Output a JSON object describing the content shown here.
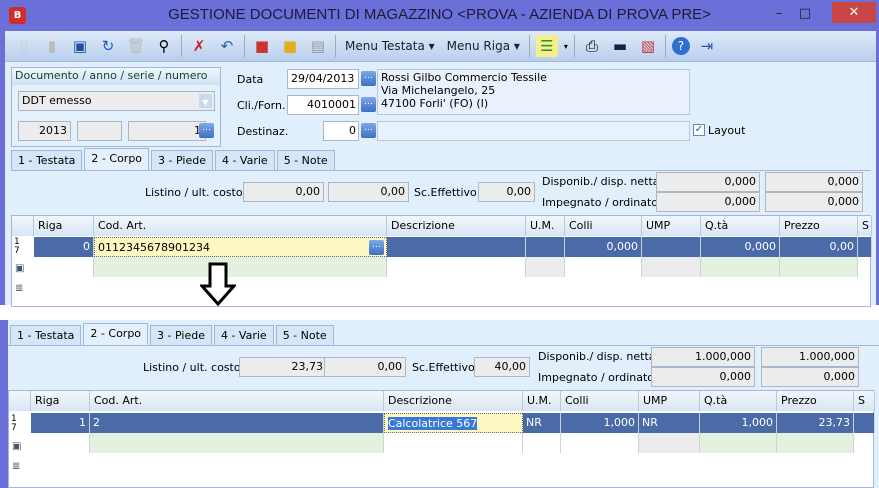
{
  "window": {
    "title": "GESTIONE DOCUMENTI DI MAGAZZINO <PROVA - AZIENDA DI PROVA PRE>",
    "app_icon": "B"
  },
  "toolbar": {
    "icons": [
      "new-doc-icon",
      "open-icon",
      "save-icon",
      "undo-icon",
      "delete-icon",
      "binoculars-icon",
      "cancel-edit-icon",
      "undo-edit-icon",
      "red-book-icon",
      "yellow-book-icon",
      "document-icon",
      "list-icon",
      "print-icon",
      "monitor-icon",
      "pdf-icon",
      "help-icon",
      "exit-icon"
    ],
    "menu_testata": "Menu Testata",
    "menu_riga": "Menu Riga"
  },
  "header": {
    "doc_group_label": "Documento / anno / serie / numero",
    "doc_type": "DDT emesso",
    "anno": "2013",
    "serie": "",
    "numero": "1",
    "data_label": "Data",
    "data": "29/04/2013",
    "cli_label": "Cli./Forn.",
    "cli": "4010001",
    "dest_label": "Destinaz.",
    "dest": "0",
    "address": [
      "Rossi Gilbo  Commercio Tessile",
      "Via Michelangelo, 25",
      "47100 Forli'  (FO)  (I)"
    ],
    "layout_label": "Layout",
    "layout_checked": true
  },
  "tabs": [
    "1 - Testata",
    "2 - Corpo",
    "3 - Piede",
    "4 - Varie",
    "5 - Note"
  ],
  "columns": [
    "Riga",
    "Cod. Art.",
    "Descrizione",
    "U.M.",
    "Colli",
    "UMP",
    "Q.tà",
    "Prezzo",
    "S"
  ],
  "info_labels": {
    "listino": "Listino / ult. costo",
    "sconto": "Sc.Effettivo",
    "disp": "Disponib./ disp. netta",
    "imp": "Impegnato / ordinato"
  },
  "before": {
    "listino": "0,00",
    "ult_costo": "0,00",
    "sconto": "0,00",
    "disp": "0,000",
    "disp_netta": "0,000",
    "impegnato": "0,000",
    "ordinato": "0,000",
    "row": {
      "riga": "0",
      "cod": "0112345678901234",
      "descr": "",
      "um": "",
      "colli": "0,000",
      "ump": "",
      "qta": "0,000",
      "prezzo": "0,00"
    }
  },
  "after": {
    "listino": "23,73",
    "ult_costo": "0,00",
    "sconto": "40,00",
    "disp": "1.000,000",
    "disp_netta": "1.000,000",
    "impegnato": "0,000",
    "ordinato": "0,000",
    "row": {
      "riga": "1",
      "cod": "2",
      "descr": "Calcolatrice 567",
      "um": "NR",
      "colli": "1,000",
      "ump": "NR",
      "qta": "1,000",
      "prezzo": "23,73"
    }
  },
  "row_header": "1\n7"
}
